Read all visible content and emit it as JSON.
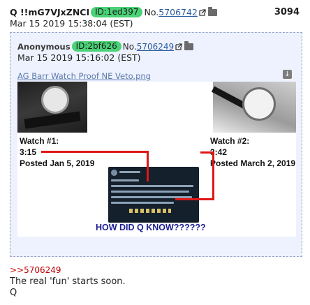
{
  "post": {
    "tripcode": "Q !!mG7VJxZNCI",
    "id": "ID:1ed397",
    "no_label": "No.",
    "post_number": "5706742",
    "count": "3094",
    "date": "Mar 15 2019 15:38:04 (EST)",
    "reply_link": ">>5706249",
    "body": [
      "The real 'fun' starts soon.",
      "Q"
    ]
  },
  "quoted": {
    "name": "Anonymous",
    "id": "ID:2bf626",
    "no_label": "No.",
    "post_number": "5706249",
    "date": "Mar 15 2019 15:16:02 (EST)",
    "filename": "AG Barr Watch Proof NE Veto.png"
  },
  "image": {
    "watch1": {
      "title": "Watch #1:",
      "time": "3:15",
      "posted": "Posted Jan 5, 2019"
    },
    "watch2": {
      "title": "Watch #2:",
      "time": "3:42",
      "posted": "Posted March 2, 2019"
    },
    "caption": "HOW DID Q KNOW??????"
  },
  "colors": {
    "id_badge": "#4ad276",
    "link": "#2b5a9e",
    "reply_link": "#bb0000",
    "arrow": "#e01616",
    "caption": "#1d1e8f",
    "quote_bg": "#eef2ff"
  },
  "icons": [
    "external-link-icon",
    "folder-icon",
    "download-icon"
  ]
}
